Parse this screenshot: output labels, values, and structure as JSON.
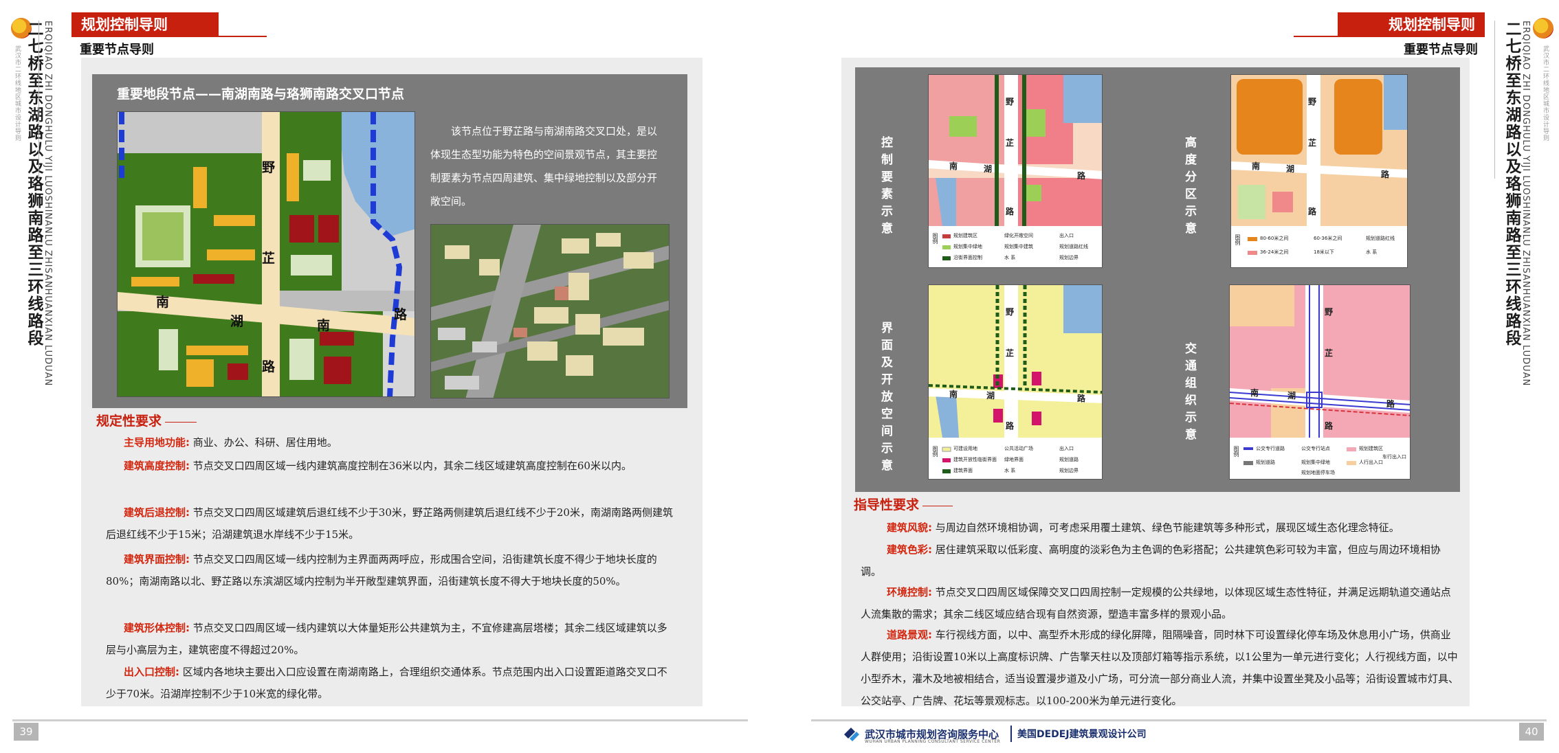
{
  "header": {
    "bar_title": "规划控制导则",
    "sub_title": "重要节点导则"
  },
  "spine": {
    "small_text": "武汉市二环线地区城市设计导则",
    "title": "二七桥至东湖路以及珞狮南路至三环线路段",
    "english": "ERQIQIAO ZHI DONGHULU YIJI LUOSHINANLU ZHISANHUANXIAN LUDUAN"
  },
  "left": {
    "panel_title": "重要地段节点——南湖南路与珞狮南路交叉口节点",
    "description": "该节点位于野芷路与南湖南路交叉口处，是以体现生态型功能为特色的空间景观节点，其主要控制要素为节点四周建筑、集中绿地控制以及部分开敞空间。",
    "map_roads": {
      "ye": "野",
      "zhi": "芷",
      "lu1": "路",
      "nan1": "南",
      "hu": "湖",
      "lu2": "路",
      "nan2": "南",
      "lu3": "路"
    },
    "section_title": "规定性要求",
    "requirements": [
      {
        "label": "主导用地功能:",
        "text": "商业、办公、科研、居住用地。"
      },
      {
        "label": "建筑高度控制:",
        "text": "节点交叉口四周区域一线内建筑高度控制在36米以内，其余二线区域建筑高度控制在60米以内。"
      },
      {
        "label": "建筑后退控制:",
        "text": "节点交叉口四周区域建筑后退红线不少于30米，野芷路两侧建筑后退红线不少于20米，南湖南路两侧建筑后退红线不少于15米；沿湖建筑退水岸线不少于15米。"
      },
      {
        "label": "建筑界面控制:",
        "text": "节点交叉口四周区域一线内控制为主界面两两呼应，形成围合空间，沿街建筑长度不得少于地块长度的80%；南湖南路以北、野芷路以东滨湖区域内控制为半开敞型建筑界面，沿街建筑长度不得大于地块长度的50%。"
      },
      {
        "label": "建筑形体控制:",
        "text": "节点交叉口四周区域一线内建筑以大体量矩形公共建筑为主，不宜修建高层塔楼；其余二线区域建筑以多层与小高层为主，建筑密度不得超过20%。"
      },
      {
        "label": "出入口控制:",
        "text": "区域内各地块主要出入口应设置在南湖南路上，合理组织交通体系。节点范围内出入口设置距道路交叉口不少于70米。沿湖岸控制不少于10米宽的绿化带。"
      }
    ],
    "page_number": "39"
  },
  "right": {
    "diagrams": [
      {
        "label": "控制要素示意",
        "roads": [
          "野",
          "芷",
          "路",
          "南",
          "湖",
          "路"
        ],
        "legend_title": "图例",
        "legend": [
          "规划建筑区",
          "绿化开敞空间",
          "出入口",
          "规划集中绿地",
          "规划集中建筑",
          "规划道路红线",
          "沿街界面控制",
          "水 系",
          "规划边界"
        ]
      },
      {
        "label": "高度分区示意",
        "roads": [
          "野",
          "芷",
          "路",
          "南",
          "湖",
          "路"
        ],
        "legend_title": "图例",
        "legend": [
          "80-60米之间",
          "60-36米之间",
          "规划道路红线",
          "36-24米之间",
          "18米以下",
          "水 系"
        ]
      },
      {
        "label": "界面及开放空间示意",
        "roads": [
          "野",
          "芷",
          "路",
          "南",
          "湖",
          "路"
        ],
        "legend_title": "图例",
        "legend": [
          "可建设用地",
          "公共活动广场",
          "出入口",
          "建筑开放性临街界面",
          "绿地界面",
          "规划道路",
          "建筑界面",
          "水 系",
          "规划边界"
        ]
      },
      {
        "label": "交通组织示意",
        "roads": [
          "野",
          "芷",
          "路",
          "南",
          "湖",
          "路"
        ],
        "legend_title": "图例",
        "legend": [
          "公交专行道路",
          "公交专行站点",
          "规划建筑区",
          "车行出入口",
          "规划道路",
          "规划集中绿地",
          "人行出入口",
          "规划地面停车场"
        ]
      }
    ],
    "section_title": "指导性要求",
    "requirements": [
      {
        "label": "建筑风貌:",
        "text": "与周边自然环境相协调，可考虑采用覆土建筑、绿色节能建筑等多种形式，展现区域生态化理念特征。"
      },
      {
        "label": "建筑色彩:",
        "text": "居住建筑采取以低彩度、高明度的淡彩色为主色调的色彩搭配；公共建筑色彩可较为丰富，但应与周边环境相协调。"
      },
      {
        "label": "环境控制:",
        "text": "节点交叉口四周区域保障交叉口四周控制一定规模的公共绿地，以体现区域生态性特征，并满足远期轨道交通站点人流集散的需求；其余二线区域应结合现有自然资源，塑造丰富多样的景观小品。"
      },
      {
        "label": "道路景观:",
        "text": "车行视线方面，以中、高型乔木形成的绿化屏障，阻隔噪音，同时林下可设置绿化停车场及休息用小广场，供商业人群使用；沿街设置10米以上高度标识牌、广告擎天柱以及顶部灯箱等指示系统，以1公里为一单元进行变化；人行视线方面，以中小型乔木，灌木及地被相结合，适当设置漫步道及小广场，可分流一部分商业人流，并集中设置坐凳及小品等；沿街设置城市灯具、公交站亭、广告牌、花坛等景观标志。以100-200米为单元进行变化。"
      }
    ],
    "footer_org1": "武汉市城市规划咨询服务中心",
    "footer_org1_en": "WUHAN URBAN PLANNING CONSULTANT SERVICE CENTER",
    "footer_org2": "美国DEDEJ建筑景观设计公司",
    "page_number": "40"
  },
  "colors": {
    "brand_red": "#c8200f",
    "panel_gray": "#7b7b7b",
    "content_bg": "#ececec",
    "green": "#3f7a1c",
    "yellow": "#f0b12a",
    "dark_red": "#a0141a",
    "water": "#89b3db"
  }
}
